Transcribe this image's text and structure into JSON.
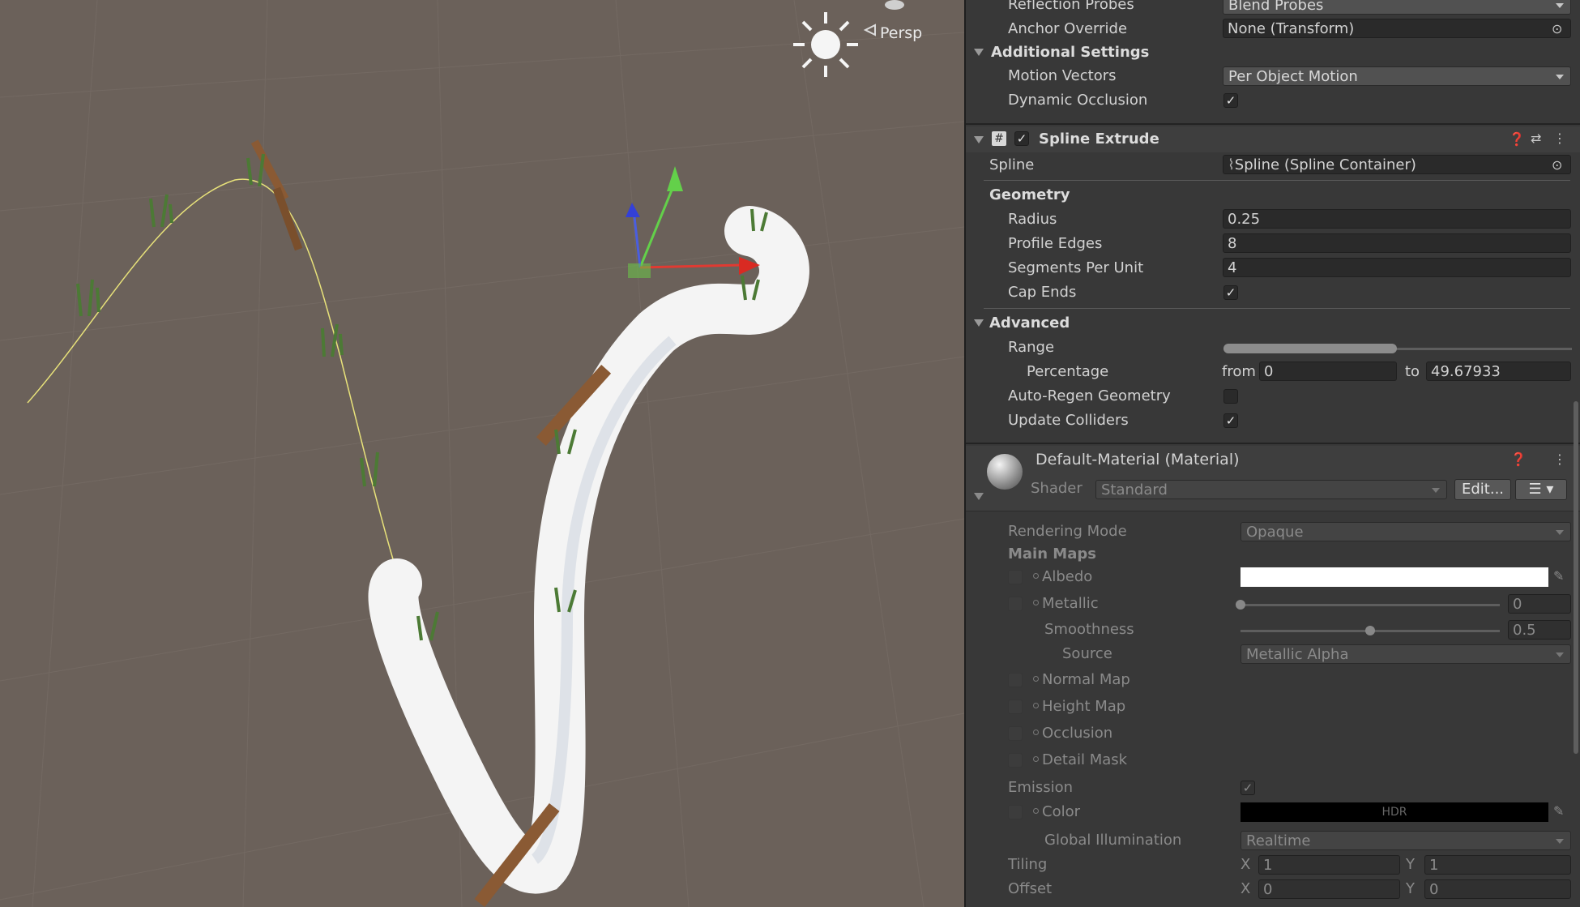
{
  "scene": {
    "camera_mode": "Persp"
  },
  "inspector": {
    "mesh_renderer": {
      "reflection_probes_label": "Reflection Probes",
      "reflection_probes_value": "Blend Probes",
      "anchor_override_label": "Anchor Override",
      "anchor_override_value": "None (Transform)",
      "additional_settings_label": "Additional Settings",
      "motion_vectors_label": "Motion Vectors",
      "motion_vectors_value": "Per Object Motion",
      "dynamic_occlusion_label": "Dynamic Occlusion",
      "dynamic_occlusion_checked": true
    },
    "spline_extrude": {
      "title": "Spline Extrude",
      "enabled": true,
      "spline_label": "Spline",
      "spline_value": "Spline (Spline Container)",
      "geometry_label": "Geometry",
      "radius_label": "Radius",
      "radius_value": "0.25",
      "profile_edges_label": "Profile Edges",
      "profile_edges_value": "8",
      "segments_label": "Segments Per Unit",
      "segments_value": "4",
      "cap_ends_label": "Cap Ends",
      "cap_ends_checked": true,
      "advanced_label": "Advanced",
      "range_label": "Range",
      "range_fraction": [
        0,
        0.4968
      ],
      "percentage_label": "Percentage",
      "from_label": "from",
      "from_value": "0",
      "to_label": "to",
      "to_value": "49.67933",
      "auto_regen_label": "Auto-Regen Geometry",
      "auto_regen_checked": false,
      "update_colliders_label": "Update Colliders",
      "update_colliders_checked": true
    },
    "material": {
      "title": "Default-Material (Material)",
      "shader_label": "Shader",
      "shader_value": "Standard",
      "edit_label": "Edit...",
      "rendering_mode_label": "Rendering Mode",
      "rendering_mode_value": "Opaque",
      "main_maps_label": "Main Maps",
      "albedo_label": "Albedo",
      "albedo_color": "#ffffff",
      "metallic_label": "Metallic",
      "metallic_value": "0",
      "metallic_fraction": 0,
      "smoothness_label": "Smoothness",
      "smoothness_value": "0.5",
      "smoothness_fraction": 0.5,
      "source_label": "Source",
      "source_value": "Metallic Alpha",
      "normal_map_label": "Normal Map",
      "height_map_label": "Height Map",
      "occlusion_label": "Occlusion",
      "detail_mask_label": "Detail Mask",
      "emission_label": "Emission",
      "emission_checked": true,
      "color_label": "Color",
      "emission_color": "#000000",
      "hdr_label": "HDR",
      "gi_label": "Global Illumination",
      "gi_value": "Realtime",
      "tiling_label": "Tiling",
      "tiling_x_label": "X",
      "tiling_x": "1",
      "tiling_y_label": "Y",
      "tiling_y": "1",
      "offset_label": "Offset",
      "offset_x_label": "X",
      "offset_x": "0",
      "offset_y_label": "Y",
      "offset_y": "0"
    }
  }
}
